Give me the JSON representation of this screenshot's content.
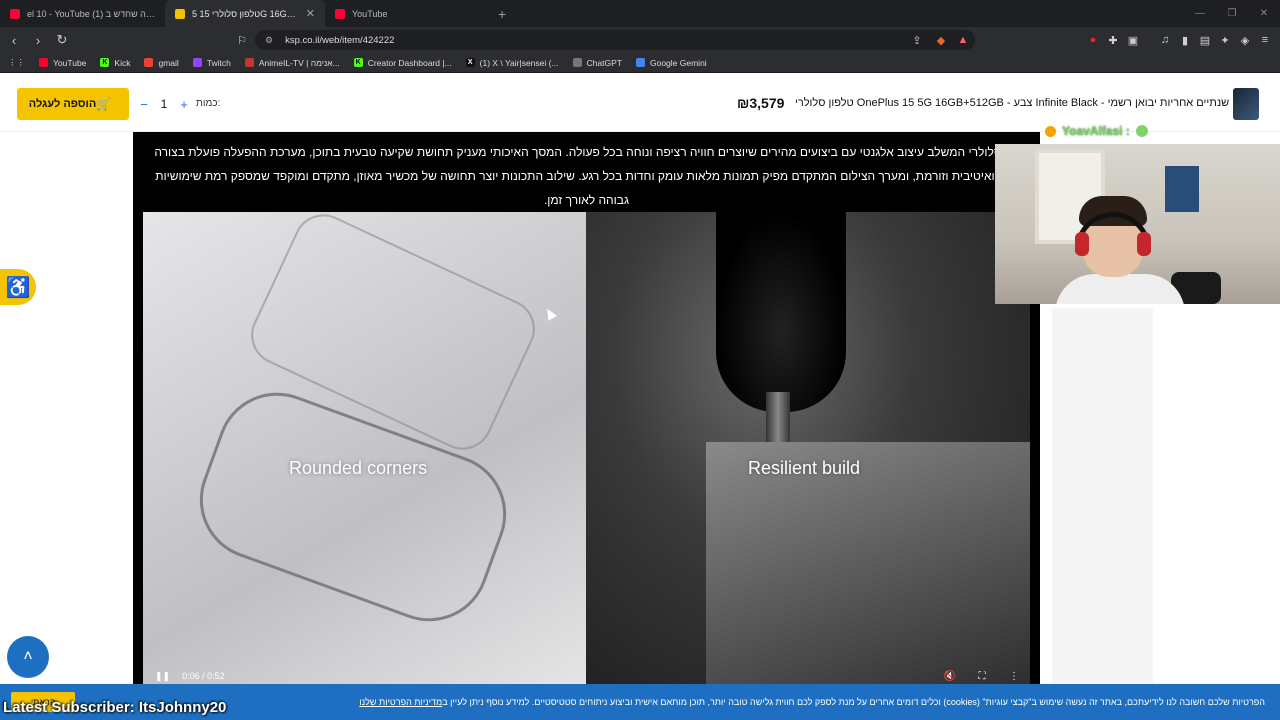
{
  "browser": {
    "tabs": [
      {
        "label": "el 10 - YouTube (1) כל מה שחדש ב-",
        "icon": "youtube-icon",
        "active": false
      },
      {
        "label": "טלפון סלולרי 15 5G 16GB 512GB",
        "icon": "ksp-icon",
        "active": true
      },
      {
        "label": "YouTube",
        "icon": "youtube-icon",
        "active": false
      }
    ],
    "url": "ksp.co.il/web/item/424222",
    "bookmarks": [
      {
        "label": "YouTube",
        "color": "#ff0033"
      },
      {
        "label": "Kick",
        "color": "#53fc18"
      },
      {
        "label": "gmail",
        "color": "#ea4335"
      },
      {
        "label": "Twitch",
        "color": "#9146ff"
      },
      {
        "label": "AnimeIL-TV | אנימה...",
        "color": "#c0392b"
      },
      {
        "label": "Creator Dashboard |...",
        "color": "#53fc18"
      },
      {
        "label": "(1) X \\ Yair|sensei (...",
        "color": "#111111"
      },
      {
        "label": "ChatGPT",
        "color": "#777777"
      },
      {
        "label": "Google Gemini",
        "color": "#4285f4"
      }
    ]
  },
  "product": {
    "title": "טלפון סלולרי OnePlus 15 5G 16GB+512GB - צבע Infinite Black - שנתיים אחריות יבואן רשמי",
    "price": "₪3,579",
    "qty_label": "כמות:",
    "qty_value": "1",
    "add_to_cart": "הוספה לעגלה"
  },
  "description": "פון סלולרי המשלב עיצוב אלגנטי עם ביצועים מהירים שיוצרים חוויה רציפה ונוחה בכל פעולה. המסך האיכותי מעניק תחושת שקיעה טבעית בתוכן, מערכת ההפעלה פועלת בצורה אינטואיטיבית וזורמת, ומערך הצילום המתקדם מפיק תמונות מלאות עומק וחדות בכל רגע. שילוב התכונות יוצר תחושה של מכשיר מאוזן, מתקדם ומוקפד שמספק רמת שימושיות גבוהה לאורך זמן.",
  "video": {
    "caption_left": "Rounded corners",
    "caption_right": "Resilient build",
    "time": "0:06 / 0:52"
  },
  "stream": {
    "chat_user": "YoavAlfasi :",
    "latest_subscriber": "Latest Subscriber: ItsJohnny20"
  },
  "cookie": {
    "text": "הפרטיות שלכם חשובה לנו לידיעתכם, באתר זה נעשה שימוש ב\"קבצי עוגיות\" (cookies) וכלים דומים אחרים על מנת לספק לכם חווית גלישה טובה יותר, תוכן מותאם אישית וביצוע ניתוחים סטטיסטיים. למידע נוסף ניתן לעיין ב",
    "link": "מדיניות הפרטיות שלנו",
    "button": "קראתי"
  }
}
